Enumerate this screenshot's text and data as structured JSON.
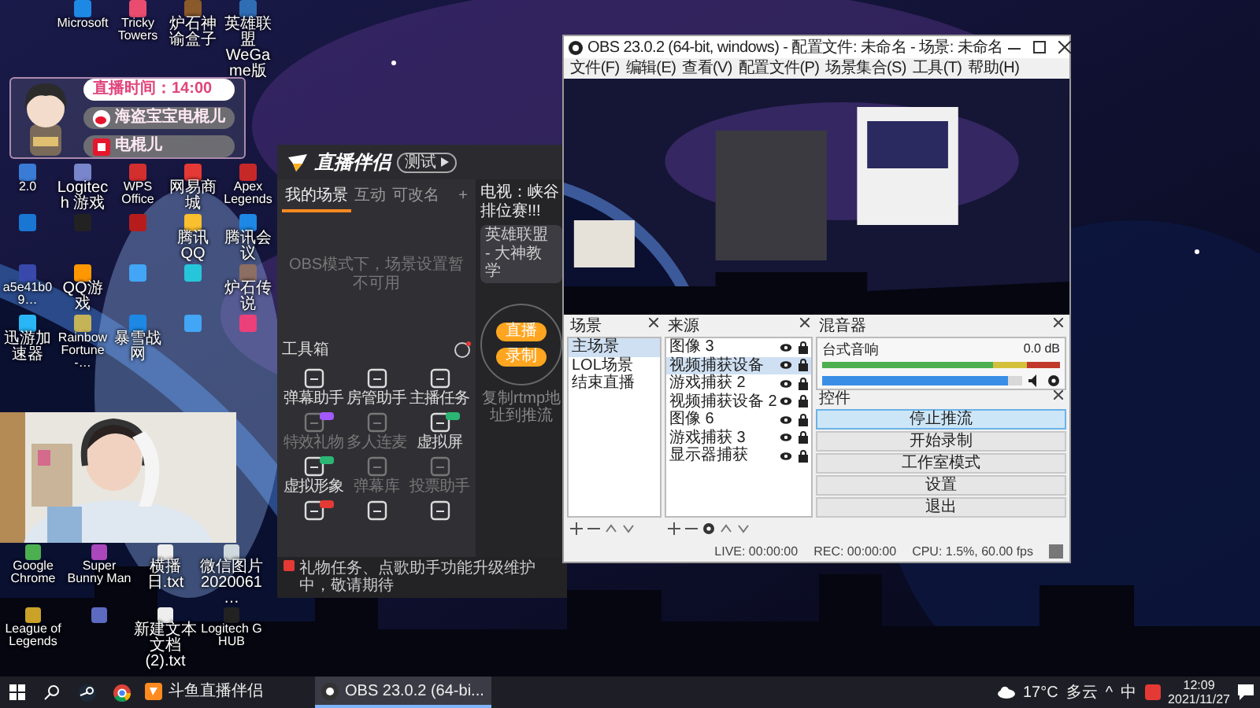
{
  "desktop": {
    "top_icons": [
      {
        "label": "Microsoft",
        "color": "#1e88e5"
      },
      {
        "label": "Tricky Towers",
        "color": "#e94c6f"
      },
      {
        "label": "炉石神谕盒子",
        "color": "#8b5a2b"
      },
      {
        "label": "英雄联盟 WeGame版",
        "color": "#2f6db5"
      }
    ],
    "icon_rows": [
      [
        {
          "label": "2.0",
          "color": "#3a7bd5"
        },
        {
          "label": "Logitech 游戏",
          "color": "#7986cb"
        },
        {
          "label": "WPS Office",
          "color": "#d32f2f"
        },
        {
          "label": "网易商城",
          "color": "#e53935"
        },
        {
          "label": "Apex Legends",
          "color": "#c62828"
        }
      ],
      [
        {
          "color": "#1976d2"
        },
        {
          "color": "#222222"
        },
        {
          "color": "#b71c1c"
        },
        {
          "label": "腾讯QQ",
          "color": "#fbc02d"
        },
        {
          "label": "腾讯会议",
          "color": "#1e88e5"
        }
      ],
      [
        {
          "label": "a5e41b09…",
          "color": "#3949ab"
        },
        {
          "label": "QQ游戏",
          "color": "#ff9800"
        },
        {
          "color": "#42a5f5"
        },
        {
          "color": "#26c6da"
        },
        {
          "label": "炉石传说",
          "color": "#8d6e63"
        }
      ],
      [
        {
          "label": "迅游加速器",
          "color": "#29b6f6"
        },
        {
          "label": "Rainbow Fortune -…",
          "color": "#c5b358"
        },
        {
          "label": "暴雪战网",
          "color": "#1e88e5"
        },
        {
          "color": "#42a5f5"
        },
        {
          "color": "#ec407a"
        }
      ]
    ],
    "lower_rows": [
      [
        {
          "label": "Google Chrome",
          "color": "#4caf50"
        },
        {
          "label": "Super Bunny Man",
          "color": "#ab47bc"
        },
        {
          "label": "横播日.txt",
          "color": "#eeeeee"
        },
        {
          "label": "微信图片 2020061…",
          "color": "#cfd8dc"
        }
      ],
      [
        {
          "label": "League of Legends",
          "color": "#c9a227"
        },
        {
          "color": "#5c6bc0"
        },
        {
          "label": "新建文本文档 (2).txt",
          "color": "#eeeeee"
        },
        {
          "label": "Logitech G HUB",
          "color": "#222222"
        }
      ]
    ]
  },
  "overlay_widget": {
    "stream_time": "直播时间：14:00",
    "lines": [
      {
        "kind": "weibo",
        "text": "海盗宝宝电棍儿"
      },
      {
        "kind": "app",
        "text": "电棍儿"
      }
    ]
  },
  "webcam": {
    "kind": "picture"
  },
  "zhibo_window": {
    "app_name": "直播伴侣",
    "badge": "测试",
    "tabs": [
      {
        "label": "我的场景",
        "selected": true
      },
      {
        "label": "互动",
        "selected": false
      },
      {
        "label": "可改名",
        "selected": false
      }
    ],
    "add_tab": "+",
    "scene_message": "OBS模式下，场景设置暂不可用",
    "toolbox_title": "工具箱",
    "tools": [
      {
        "label": "弹幕助手",
        "disabled": false
      },
      {
        "label": "房管助手",
        "disabled": false
      },
      {
        "label": "主播任务",
        "disabled": false
      },
      {
        "label": "特效礼物",
        "disabled": true,
        "badge": {
          "color": "#a259ff"
        }
      },
      {
        "label": "多人连麦",
        "disabled": true
      },
      {
        "label": "虚拟屏",
        "disabled": false,
        "badge": {
          "color": "#2bb673"
        }
      },
      {
        "label": "虚拟形象",
        "disabled": false,
        "badge": {
          "color": "#2bb673"
        }
      },
      {
        "label": "弹幕库",
        "disabled": true
      },
      {
        "label": "投票助手",
        "disabled": true
      },
      {
        "disabled": false,
        "badge": {
          "color": "#e53935"
        }
      },
      {
        "disabled": false
      },
      {
        "disabled": false
      }
    ],
    "stream_title": "电视：峡谷排位赛!!!",
    "category": "英雄联盟 - 大神教学",
    "circle_buttons": [
      "直播",
      "录制"
    ],
    "hint": "复制rtmp地址到推流",
    "notice": "礼物任务、点歌助手功能升级维护中，敬请期待"
  },
  "obs_window": {
    "title": "OBS 23.0.2 (64-bit, windows) - 配置文件: 未命名 - 场景: 未命名",
    "menu": [
      "文件(F)",
      "编辑(E)",
      "查看(V)",
      "配置文件(P)",
      "场景集合(S)",
      "工具(T)",
      "帮助(H)"
    ],
    "preview": {
      "kind": "picture"
    },
    "scenes": {
      "title": "场景",
      "items": [
        {
          "label": "主场景",
          "selected": true
        },
        {
          "label": "LOL场景",
          "selected": false
        },
        {
          "label": "结束直播",
          "selected": false
        }
      ]
    },
    "sources": {
      "title": "来源",
      "items": [
        {
          "label": "图像 3",
          "selected": false
        },
        {
          "label": "视频捕获设备",
          "selected": true
        },
        {
          "label": "游戏捕获 2",
          "selected": false
        },
        {
          "label": "视频捕获设备 2",
          "selected": false
        },
        {
          "label": "图像 6",
          "selected": false
        },
        {
          "label": "游戏捕获 3",
          "selected": false
        },
        {
          "label": "显示器捕获",
          "selected": false
        }
      ]
    },
    "mixer": {
      "title": "混音器",
      "tracks": [
        {
          "name": "台式音响",
          "reading": "0.0 dB",
          "level": 0.93
        }
      ]
    },
    "controls": {
      "title": "控件",
      "buttons": [
        {
          "label": "停止推流",
          "selected": true
        },
        {
          "label": "开始录制",
          "selected": false
        },
        {
          "label": "工作室模式",
          "selected": false
        },
        {
          "label": "设置",
          "selected": false
        },
        {
          "label": "退出",
          "selected": false
        }
      ]
    },
    "status": [
      "LIVE: 00:00:00",
      "REC: 00:00:00",
      "CPU: 1.5%, 60.00 fps"
    ]
  },
  "taskbar": {
    "icons": [
      {
        "kind": "start"
      },
      {
        "kind": "search"
      },
      {
        "kind": "steam"
      },
      {
        "kind": "chrome"
      }
    ],
    "tasks": [
      {
        "kind": "apptask",
        "label": "斗鱼直播伴侣",
        "selected": false
      },
      {
        "kind": "obstask",
        "label": "OBS 23.0.2 (64-bi...",
        "selected": true
      }
    ],
    "weather": {
      "temp": "17°C",
      "condition": "多云"
    },
    "tray": [
      "^",
      "中"
    ],
    "time": "12:09",
    "date": "2021/11/27"
  }
}
